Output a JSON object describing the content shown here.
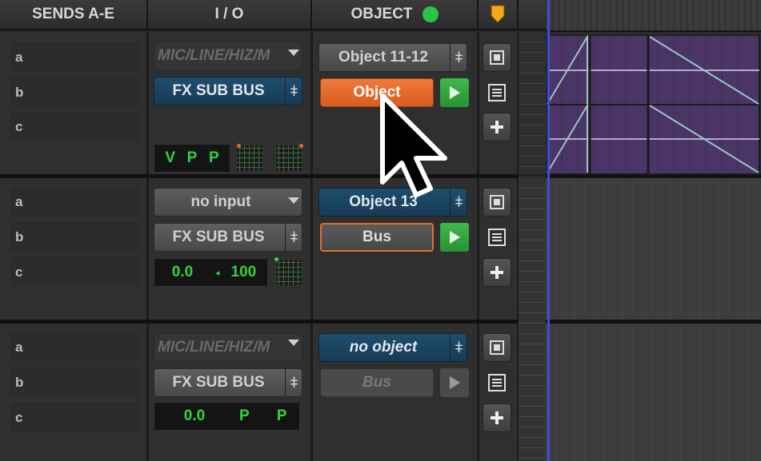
{
  "header": {
    "sends_title": "SENDS A-E",
    "io_title": "I / O",
    "object_title": "OBJECT"
  },
  "tracks": [
    {
      "sends": [
        "a",
        "b",
        "c"
      ],
      "input": "MIC/LINE/HIZ/M",
      "output": "FX SUB BUS",
      "meter": [
        "V",
        "P",
        "P"
      ],
      "object_select": "Object 11-12",
      "mode_button": "Object"
    },
    {
      "sends": [
        "a",
        "b",
        "c"
      ],
      "input": "no input",
      "output": "FX SUB BUS",
      "volume": "0.0",
      "pan": "100",
      "object_select": "Object 13",
      "mode_button": "Bus"
    },
    {
      "sends": [
        "a",
        "b",
        "c"
      ],
      "input": "MIC/LINE/HIZ/M",
      "output": "FX SUB BUS",
      "volume": "0.0",
      "meter_letters": [
        "P",
        "P"
      ],
      "object_select": "no object",
      "mode_button": "Bus"
    }
  ],
  "icons": {
    "pin": "pin-icon",
    "play": "play-icon",
    "plus": "plus-icon",
    "list": "list-icon",
    "square": "square-icon",
    "cursor": "mouse-cursor-icon"
  },
  "colors": {
    "accent_orange": "#e0702e",
    "accent_blue": "#1f4e6e",
    "green": "#32d33e",
    "clip_purple": "#5a3f78"
  }
}
